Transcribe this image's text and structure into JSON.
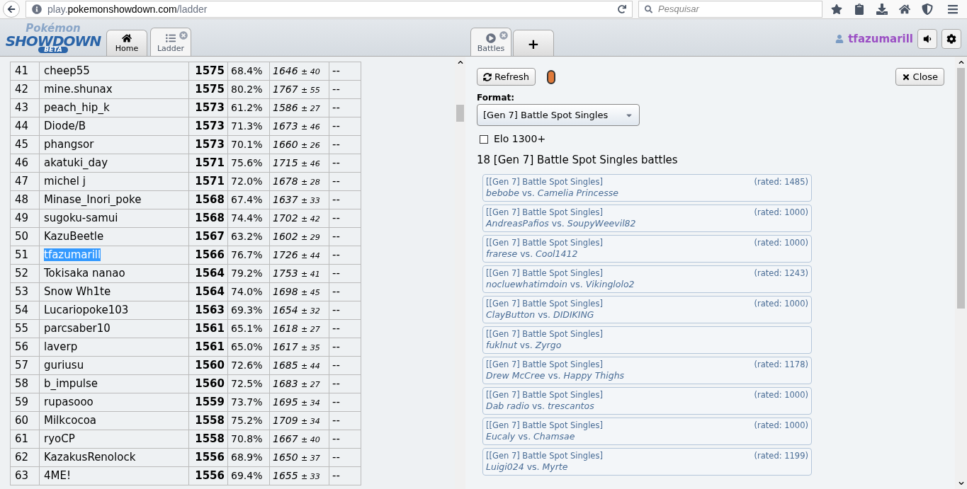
{
  "browser": {
    "url_host": "play.pokemonshowdown.com",
    "url_path": "/ladder",
    "search_placeholder": "Pesquisar"
  },
  "logo": {
    "line1": "Pokémon",
    "line2": "SHOWDOWN",
    "badge": "BETA"
  },
  "left_tabs": [
    {
      "label": "Home",
      "selected": false
    },
    {
      "label": "Ladder",
      "selected": true
    }
  ],
  "right_tabs": [
    {
      "label": "Battles",
      "selected": true
    },
    {
      "label": "+",
      "selected": false
    }
  ],
  "user": {
    "name": "tfazumarill"
  },
  "ladder_rows": [
    {
      "rank": "41",
      "name": "cheep55",
      "elo": "1575",
      "gxe": "68.4%",
      "glicko": "1646",
      "dev": "± 40",
      "col_6": "--",
      "selected": false
    },
    {
      "rank": "42",
      "name": "mine.shunax",
      "elo": "1575",
      "gxe": "80.2%",
      "glicko": "1767",
      "dev": "± 55",
      "col_6": "--",
      "selected": false
    },
    {
      "rank": "43",
      "name": "peach_hip_k",
      "elo": "1573",
      "gxe": "61.2%",
      "glicko": "1586",
      "dev": "± 27",
      "col_6": "--",
      "selected": false
    },
    {
      "rank": "44",
      "name": "Diode/B",
      "elo": "1573",
      "gxe": "71.3%",
      "glicko": "1673",
      "dev": "± 46",
      "col_6": "--",
      "selected": false
    },
    {
      "rank": "45",
      "name": "phangsor",
      "elo": "1573",
      "gxe": "70.1%",
      "glicko": "1660",
      "dev": "± 26",
      "col_6": "--",
      "selected": false
    },
    {
      "rank": "46",
      "name": "akatuki_day",
      "elo": "1571",
      "gxe": "75.6%",
      "glicko": "1715",
      "dev": "± 46",
      "col_6": "--",
      "selected": false
    },
    {
      "rank": "47",
      "name": "michel j",
      "elo": "1571",
      "gxe": "72.0%",
      "glicko": "1678",
      "dev": "± 28",
      "col_6": "--",
      "selected": false
    },
    {
      "rank": "48",
      "name": "Minase_Inori_poke",
      "elo": "1568",
      "gxe": "67.4%",
      "glicko": "1637",
      "dev": "± 33",
      "col_6": "--",
      "selected": false
    },
    {
      "rank": "49",
      "name": "sugoku-samui",
      "elo": "1568",
      "gxe": "74.4%",
      "glicko": "1702",
      "dev": "± 42",
      "col_6": "--",
      "selected": false
    },
    {
      "rank": "50",
      "name": "KazuBeetle",
      "elo": "1567",
      "gxe": "63.2%",
      "glicko": "1602",
      "dev": "± 29",
      "col_6": "--",
      "selected": false
    },
    {
      "rank": "51",
      "name": "tfazumarill",
      "elo": "1566",
      "gxe": "76.7%",
      "glicko": "1726",
      "dev": "± 44",
      "col_6": "--",
      "selected": true
    },
    {
      "rank": "52",
      "name": "Tokisaka nanao",
      "elo": "1564",
      "gxe": "79.2%",
      "glicko": "1753",
      "dev": "± 41",
      "col_6": "--",
      "selected": false
    },
    {
      "rank": "53",
      "name": "Snow Wh1te",
      "elo": "1564",
      "gxe": "74.0%",
      "glicko": "1698",
      "dev": "± 45",
      "col_6": "--",
      "selected": false
    },
    {
      "rank": "54",
      "name": "Lucariopoke103",
      "elo": "1563",
      "gxe": "69.3%",
      "glicko": "1654",
      "dev": "± 32",
      "col_6": "--",
      "selected": false
    },
    {
      "rank": "55",
      "name": "parcsaber10",
      "elo": "1561",
      "gxe": "65.1%",
      "glicko": "1618",
      "dev": "± 27",
      "col_6": "--",
      "selected": false
    },
    {
      "rank": "56",
      "name": "laverp",
      "elo": "1561",
      "gxe": "65.0%",
      "glicko": "1617",
      "dev": "± 35",
      "col_6": "--",
      "selected": false
    },
    {
      "rank": "57",
      "name": "guriusu",
      "elo": "1560",
      "gxe": "72.6%",
      "glicko": "1685",
      "dev": "± 44",
      "col_6": "--",
      "selected": false
    },
    {
      "rank": "58",
      "name": "b_impulse",
      "elo": "1560",
      "gxe": "72.5%",
      "glicko": "1683",
      "dev": "± 27",
      "col_6": "--",
      "selected": false
    },
    {
      "rank": "59",
      "name": "rupasooo",
      "elo": "1559",
      "gxe": "73.7%",
      "glicko": "1695",
      "dev": "± 34",
      "col_6": "--",
      "selected": false
    },
    {
      "rank": "60",
      "name": "Milkcocoa",
      "elo": "1558",
      "gxe": "75.2%",
      "glicko": "1709",
      "dev": "± 34",
      "col_6": "--",
      "selected": false
    },
    {
      "rank": "61",
      "name": "ryoCP",
      "elo": "1558",
      "gxe": "70.8%",
      "glicko": "1667",
      "dev": "± 40",
      "col_6": "--",
      "selected": false
    },
    {
      "rank": "62",
      "name": "KazakusRenolock",
      "elo": "1556",
      "gxe": "68.9%",
      "glicko": "1650",
      "dev": "± 37",
      "col_6": "--",
      "selected": false
    },
    {
      "rank": "63",
      "name": "4ME!",
      "elo": "1556",
      "gxe": "69.4%",
      "glicko": "1655",
      "dev": "± 33",
      "col_6": "--",
      "selected": false
    }
  ],
  "battles_panel": {
    "refresh": "Refresh",
    "close": "Close",
    "format_label": "Format:",
    "format": "[Gen 7] Battle Spot Singles",
    "elo_filter": {
      "label": "Elo 1300+",
      "checked": false
    },
    "count_text": "18 [Gen 7] Battle Spot Singles battles",
    "battles": [
      {
        "format": "[[Gen 7] Battle Spot Singles]",
        "p1": "bebobe",
        "vs": "vs.",
        "p2": "Camelia Princesse",
        "rated": "(rated: 1485)"
      },
      {
        "format": "[[Gen 7] Battle Spot Singles]",
        "p1": "AndreasPafios",
        "vs": "vs.",
        "p2": "SoupyWeevil82",
        "rated": "(rated: 1000)"
      },
      {
        "format": "[[Gen 7] Battle Spot Singles]",
        "p1": "frarese",
        "vs": "vs.",
        "p2": "Cool1412",
        "rated": "(rated: 1000)"
      },
      {
        "format": "[[Gen 7] Battle Spot Singles]",
        "p1": "nocluewhatimdoin",
        "vs": "vs.",
        "p2": "Vikinglolo2",
        "rated": "(rated: 1243)"
      },
      {
        "format": "[[Gen 7] Battle Spot Singles]",
        "p1": "ClayButton",
        "vs": "vs.",
        "p2": "DIDIKING",
        "rated": "(rated: 1000)"
      },
      {
        "format": "[[Gen 7] Battle Spot Singles]",
        "p1": "fuklnut",
        "vs": "vs.",
        "p2": "Zyrgo"
      },
      {
        "format": "[[Gen 7] Battle Spot Singles]",
        "p1": "Drew McCree",
        "vs": "vs.",
        "p2": "Happy Thighs",
        "rated": "(rated: 1178)"
      },
      {
        "format": "[[Gen 7] Battle Spot Singles]",
        "p1": "Dab radio",
        "vs": "vs.",
        "p2": "trescantos",
        "rated": "(rated: 1000)"
      },
      {
        "format": "[[Gen 7] Battle Spot Singles]",
        "p1": "Eucaly",
        "vs": "vs.",
        "p2": "Chamsae",
        "rated": "(rated: 1000)"
      },
      {
        "format": "[[Gen 7] Battle Spot Singles]",
        "p1": "Luigi024",
        "vs": "vs.",
        "p2": "Myrte",
        "rated": "(rated: 1199)"
      }
    ]
  }
}
